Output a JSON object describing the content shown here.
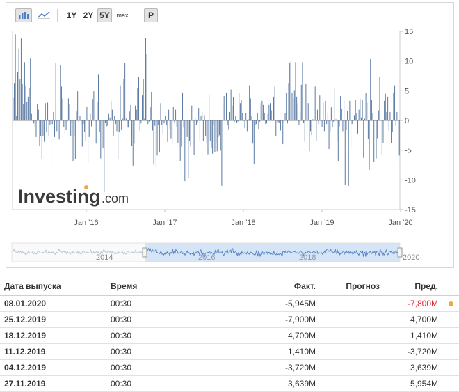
{
  "toolbar": {
    "range_buttons": [
      "1Y",
      "2Y",
      "5Y",
      "max"
    ],
    "active_range": "5Y",
    "p_button": "P",
    "icons": [
      "bar-chart-icon",
      "line-chart-icon"
    ]
  },
  "watermark": {
    "brand": "Investing",
    "suffix": ".com"
  },
  "colors": {
    "bar": "#5b7aa3",
    "navigator_fill": "#cfe0f4",
    "navigator_line": "#5a86c5",
    "negative": "#e0242b",
    "dot": "#f2a93b"
  },
  "chart_data": {
    "type": "bar",
    "x_tick_labels": [
      "Jan '16",
      "Jan '17",
      "Jan '18",
      "Jan '19",
      "Jan '20"
    ],
    "y_ticks": [
      15,
      10,
      5,
      0,
      -5,
      -10,
      -15
    ],
    "ylim": [
      -15,
      15
    ],
    "grid": false,
    "values": [
      3.8,
      6.3,
      14.5,
      0.8,
      8.1,
      12.1,
      6.9,
      13.8,
      6.2,
      2.8,
      9.8,
      5.9,
      3.1,
      4.0,
      5.4,
      10.4,
      1.1,
      0.0,
      -0.5,
      -1.0,
      -2.8,
      2.7,
      1.8,
      -4.3,
      -2.7,
      -6.4,
      -2.7,
      -3.6,
      2.9,
      -1.9,
      3.0,
      -2.6,
      -0.7,
      -7.3,
      -0.6,
      1.4,
      -2.8,
      9.6,
      -1.8,
      3.4,
      -3.2,
      9.3,
      5.7,
      3.7,
      -1.1,
      -2.4,
      -1.6,
      -0.2,
      3.7,
      2.8,
      -2.6,
      -0.3,
      -6.8,
      -2.7,
      -6.5,
      1.5,
      4.9,
      -0.3,
      0.7,
      -0.8,
      -4.4,
      -0.6,
      -2.0,
      -3.4,
      2.3,
      -7.1,
      -2.8,
      1.1,
      -1.0,
      3.6,
      4.9,
      1.4,
      -3.9,
      3.1,
      7.8,
      -1.9,
      -6.4,
      -0.9,
      -4.7,
      -12.1,
      -0.4,
      -1.0,
      -0.9,
      1.1,
      0.5,
      3.3,
      1.8,
      -2.7,
      0.8,
      -0.6,
      -1.8,
      -6.5,
      -1.9,
      5.9,
      -1.5,
      0.3,
      7.0,
      9.7,
      0.3,
      -1.2,
      -1.2,
      1.5,
      2.6,
      -4.3,
      -7.6,
      -3.9,
      2.5,
      1.8,
      5.5,
      7.3,
      -1.7,
      -0.5,
      4.2,
      6.9,
      0.3,
      13.9,
      11.2,
      -0.6,
      -0.2,
      2.2,
      4.8,
      -1.7,
      -7.4,
      -0.9,
      -7.8,
      -5.9,
      -0.8,
      -5.4,
      2.9,
      -0.8,
      -2.3,
      -0.5,
      0.8,
      -0.8,
      -3.6,
      1.8,
      -1.4,
      -3.0,
      -4.0,
      2.3,
      -0.3,
      1.8,
      -1.1,
      -3.8,
      -4.7,
      -6.8,
      -4.4,
      4.7,
      -1.2,
      -10.2,
      3.9,
      -2.8,
      -9.6,
      -3.5,
      -4.4,
      2.5,
      -0.4,
      -5.8,
      0.4,
      -0.8,
      -0.3,
      2.1,
      -3.4,
      0.7,
      1.4,
      -3.5,
      0.9,
      -2.7,
      -3.8,
      -5.7,
      4.4,
      -3.5,
      -4.7,
      -5.6,
      -0.7,
      -5.3,
      -3.8,
      -5.2,
      -2.8,
      -2.5,
      -5.1,
      -11.0,
      2.9,
      4.1,
      0.1,
      4.7,
      -0.7,
      -1.5,
      1.4,
      5.2,
      2.5,
      3.9,
      -0.2,
      0.8,
      -0.4,
      -0.2,
      4.6,
      2.9,
      3.4,
      1.3,
      0.0,
      -1.3,
      1.2,
      -1.8,
      0.2,
      5.9,
      3.7,
      0.7,
      -3.9,
      -7.3,
      -0.8,
      -0.6,
      1.3,
      -1.4,
      -0.2,
      2.9,
      3.3,
      2.6,
      1.2,
      -0.6,
      -0.5,
      1.1,
      2.6,
      2.9,
      1.7,
      0.0,
      4.0,
      5.7,
      -2.6,
      0.2,
      -0.3,
      -0.4,
      -1.7,
      0.0,
      -4.0,
      -0.4,
      1.2,
      4.6,
      -0.5,
      6.3,
      9.7,
      10.0,
      4.7,
      3.7,
      5.1,
      9.8,
      4.0,
      2.9,
      -0.7,
      1.2,
      6.0,
      9.8,
      -0.4,
      -3.6,
      6.1,
      -1.2,
      2.9,
      -5.2,
      -1.8,
      -2.5,
      0.2,
      3.2,
      5.7,
      -3.4,
      1.8,
      -0.6,
      4.2,
      -0.5,
      -1.1,
      3.0,
      -1.8,
      3.3,
      -0.6,
      1.3,
      -4.8,
      -2.0,
      2.2,
      -1.1,
      -0.2,
      5.4,
      0.2,
      -3.4,
      -6.8,
      -1.0,
      4.1,
      2.0,
      -1.8,
      3.5,
      -10.8,
      -1.6,
      1.6,
      -11.0,
      3.3,
      -4.6,
      -0.6,
      0.0,
      0.9,
      3.5,
      1.2,
      -2.2,
      1.8,
      3.6,
      0.5,
      3.5,
      -6.3,
      0.3,
      4.6,
      3.0,
      -3.1,
      -8.3,
      10.3,
      3.5,
      1.2,
      -7.0,
      0.0,
      -6.4,
      -3.0,
      1.7,
      7.4,
      0.1,
      -5.7,
      -3.8,
      3.3,
      4.5,
      1.4,
      4.0,
      -1.7,
      1.4,
      -3.8,
      -1.9,
      4.7,
      5.9,
      -0.9,
      1.4,
      -7.8,
      -5.9
    ]
  },
  "navigator": {
    "year_labels": [
      "2014",
      "2016",
      "2018",
      "2020"
    ]
  },
  "table": {
    "headers": {
      "date": "Дата выпуска",
      "time": "Время",
      "fact": "Факт.",
      "forecast": "Прогноз",
      "prev": "Пред."
    },
    "rows": [
      {
        "date": "08.01.2020",
        "time": "00:30",
        "fact": "-5,945M",
        "forecast": "",
        "prev": "-7,800M",
        "prev_negative": true,
        "dot": true
      },
      {
        "date": "25.12.2019",
        "time": "00:30",
        "fact": "-7,900M",
        "forecast": "",
        "prev": "4,700M"
      },
      {
        "date": "18.12.2019",
        "time": "00:30",
        "fact": "4,700M",
        "forecast": "",
        "prev": "1,410M"
      },
      {
        "date": "11.12.2019",
        "time": "00:30",
        "fact": "1,410M",
        "forecast": "",
        "prev": "-3,720M"
      },
      {
        "date": "04.12.2019",
        "time": "00:30",
        "fact": "-3,720M",
        "forecast": "",
        "prev": "3,639M"
      },
      {
        "date": "27.11.2019",
        "time": "00:30",
        "fact": "3,639M",
        "forecast": "",
        "prev": "5,954M"
      }
    ]
  }
}
